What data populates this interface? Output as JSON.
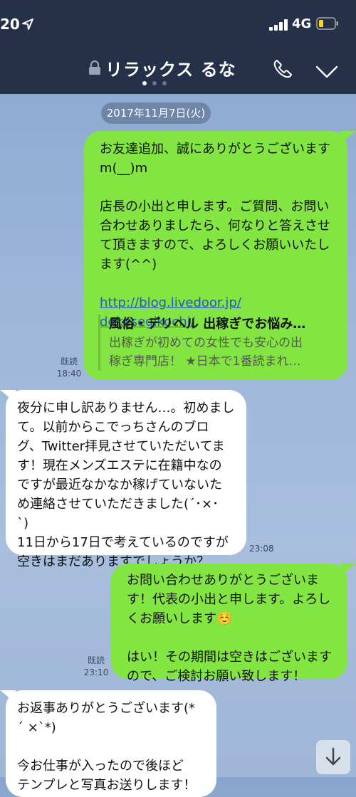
{
  "status": {
    "time": "20",
    "network": "4G"
  },
  "header": {
    "title": "リラックス るな"
  },
  "date_label": "2017年11月7日(火)",
  "messages": [
    {
      "lines": [
        "お友達追加、誠にありがとうございます",
        "m(__)m",
        "",
        "店長の小出と申します。ご質問、お問い",
        "合わせありましたら、何なりと答えさせ",
        "て頂きますので、よろしくお願いいたし",
        "ます(^^)",
        ""
      ],
      "link": [
        "http://blog.livedoor.jp/",
        "dekasegikochi/"
      ],
      "preview": {
        "title": "風俗・デリヘル 出稼ぎでお悩み…",
        "desc": [
          "出稼ぎが初めての女性でも安心の出",
          "稼ぎ専門店！ ★日本で1番読まれ…"
        ]
      },
      "read": "既読",
      "time": "18:40"
    },
    {
      "lines": [
        "夜分に申し訳ありません…。初めまし",
        "て。以前からこでっちさんのブロ",
        "グ、Twitter拝見させていただいてま",
        "す！現在メンズエステに在籍中なの",
        "ですが最近なかなか稼げていないた",
        "め連絡させていただきました(´･×･",
        "`)",
        "11日から17日で考えているのですが",
        "空きはまだありますでしょうか？"
      ],
      "time": "23:08"
    },
    {
      "lines": [
        "お問い合わせありがとうございま",
        "す！代表の小出と申します。よろし",
        "くお願いします☺️",
        "",
        "はい！その期間は空きはございます",
        "ので、ご検討お願い致します！"
      ],
      "read": "既読",
      "time": "23:10"
    },
    {
      "lines": [
        "お返事ありがとうございます(*",
        "´ ×`*)",
        "",
        "今お仕事が入ったので後ほど",
        "テンプレと写真お送りします！"
      ]
    }
  ]
}
